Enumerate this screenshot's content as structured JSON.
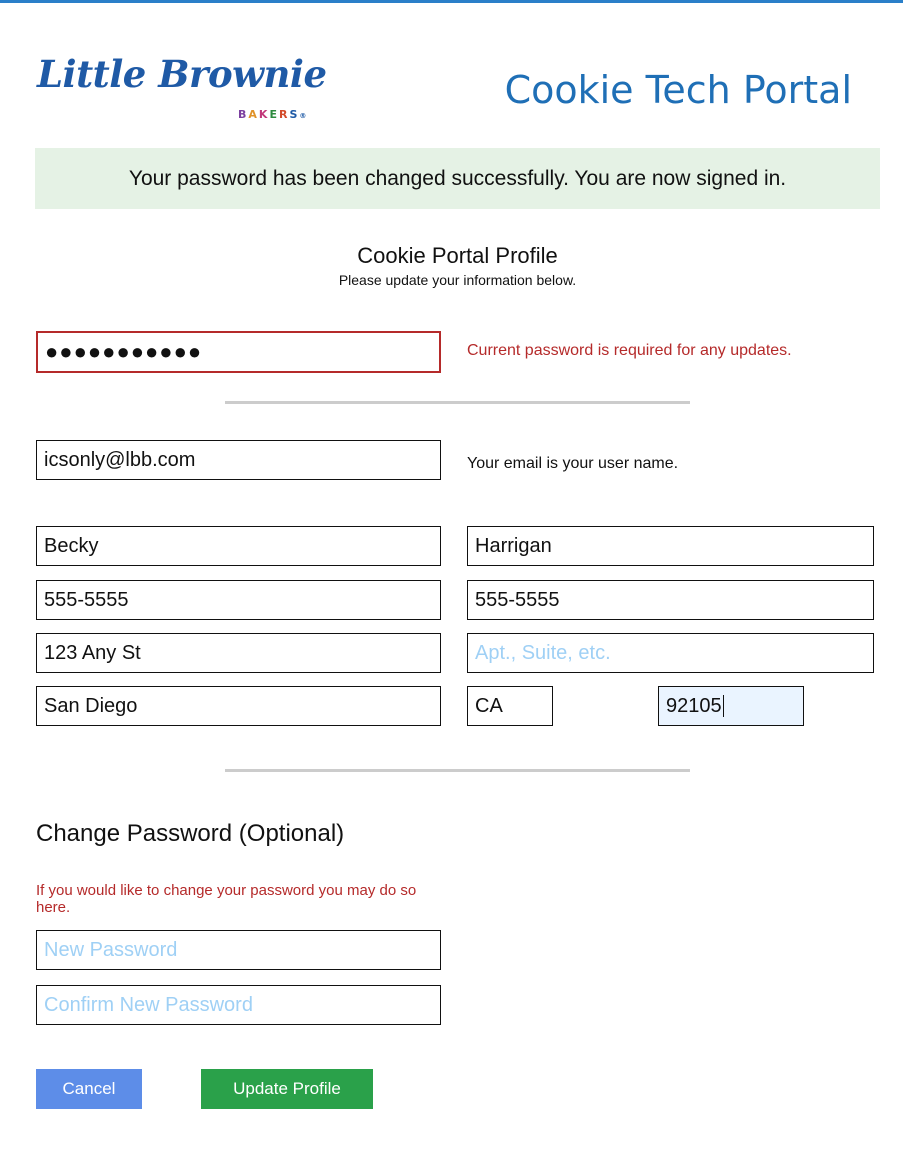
{
  "brand": {
    "logo_script": "Little Brownie",
    "logo_sub_letters": [
      "B",
      "A",
      "K",
      "E",
      "R",
      "S"
    ],
    "logo_tm": "®",
    "portal_title": "Cookie Tech Portal"
  },
  "colors": {
    "accent_blue": "#1f6fb6",
    "error_red": "#b52a2a",
    "success_bg": "#e5f2e5",
    "cancel_blue": "#5d8de8",
    "update_green": "#2aa14a",
    "placeholder": "#9fd0f5"
  },
  "banner": {
    "message": "Your password has been changed successfully. You are now signed in."
  },
  "profile": {
    "title": "Cookie Portal Profile",
    "subtitle": "Please update your information below."
  },
  "current_password": {
    "value": "●●●●●●●●●●●",
    "error": "Current password is required for any updates."
  },
  "email": {
    "value": "icsonly@lbb.com",
    "hint": "Your email is your user name."
  },
  "fields": {
    "first_name": "Becky",
    "last_name": "Harrigan",
    "phone_1": "555-5555",
    "phone_2": "555-5555",
    "address_1": "123 Any St",
    "address_2_placeholder": "Apt., Suite, etc.",
    "city": "San Diego",
    "state": "CA",
    "zip": "92105"
  },
  "change_password": {
    "title": "Change Password (Optional)",
    "note": "If you would like to change your password you may do so here.",
    "new_placeholder": "New Password",
    "confirm_placeholder": "Confirm New Password"
  },
  "buttons": {
    "cancel": "Cancel",
    "update": "Update Profile"
  }
}
